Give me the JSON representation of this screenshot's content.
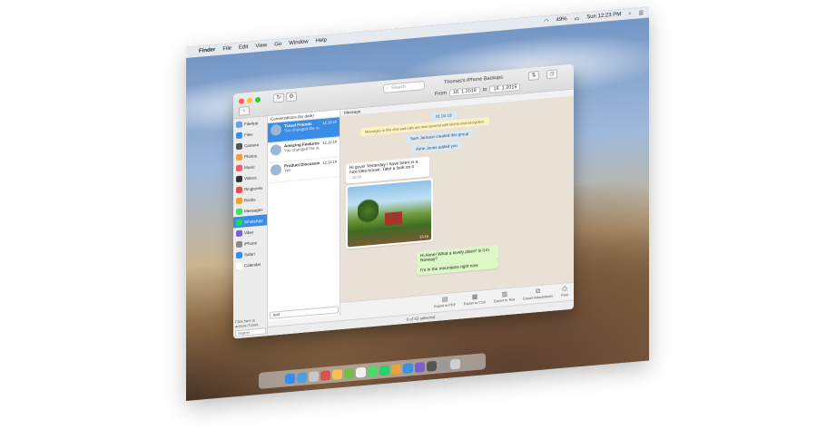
{
  "menubar": {
    "app": "Finder",
    "items": [
      "File",
      "Edit",
      "View",
      "Go",
      "Window",
      "Help"
    ],
    "battery": "49%",
    "clock": "Sun 12:23 PM"
  },
  "toolbar_top": {
    "search_placeholder": "Search",
    "backup_label": "Thomas's iPhone Backups",
    "from_label": "From",
    "from_date": "18. 1.2018",
    "to_label": "to",
    "to_date": "18. 1.2019"
  },
  "sidebar": {
    "items": [
      {
        "label": "FileApp",
        "icon": "fileapp-icon",
        "color": "#6f9fd8"
      },
      {
        "label": "Files",
        "icon": "files-icon",
        "color": "#3d8fe0"
      },
      {
        "label": "Camera",
        "icon": "camera-icon",
        "color": "#555555"
      },
      {
        "label": "Photos",
        "icon": "photos-icon",
        "color": "#e8a33a"
      },
      {
        "label": "Music",
        "icon": "music-icon",
        "color": "#f05a78"
      },
      {
        "label": "Videos",
        "icon": "videos-icon",
        "color": "#333333"
      },
      {
        "label": "Ringtones",
        "icon": "ringtones-icon",
        "color": "#e05050"
      },
      {
        "label": "Books",
        "icon": "books-icon",
        "color": "#f0a030"
      },
      {
        "label": "Messages",
        "icon": "messages-icon",
        "color": "#4cd964"
      },
      {
        "label": "WhatsApp",
        "icon": "whatsapp-icon",
        "color": "#25d366"
      },
      {
        "label": "Viber",
        "icon": "viber-icon",
        "color": "#7a5fd0"
      },
      {
        "label": "iPhone",
        "icon": "iphone-icon",
        "color": "#888888"
      },
      {
        "label": "Safari",
        "icon": "safari-icon",
        "color": "#3a8de6"
      },
      {
        "label": "Calendar",
        "icon": "calendar-icon",
        "color": "#ffffff"
      }
    ],
    "footer": "Click here to access iTunes",
    "search_placeholder": "Search"
  },
  "chatlist": {
    "header": "Conversations (by date)",
    "chats": [
      {
        "name": "Travel Friends",
        "preview": "You changed the subject to \"T...",
        "time": "12.12.18"
      },
      {
        "name": "Amazing Features...",
        "preview": "You changed the subject to \"A...",
        "time": "12.12.18"
      },
      {
        "name": "Product Discussions",
        "preview": "Yes",
        "time": "12.12.18"
      }
    ],
    "search_value": "test"
  },
  "messages": {
    "header": "Message",
    "date_pill": "01.02.19",
    "encryption_note": "Messages to this chat and calls are now secured with end-to-end encryption.",
    "system1": "Sam Jackson created this group",
    "system2": "Aime Jones added you",
    "bubble_in": "Hi guys! Yesterday I have been in a nice lake-house. Take a look on it",
    "bubble_in_time": "12:50",
    "photo_time": "13:15",
    "bubble_out": "Hi Aime! What a lovely place! Is it in Norway?",
    "bubble_out2": "I'm in the mountains right now"
  },
  "bottom_toolbar": {
    "tools": [
      {
        "label": "Export to PDF",
        "icon": "pdf-icon"
      },
      {
        "label": "Export to CSV",
        "icon": "csv-icon"
      },
      {
        "label": "Export to Text",
        "icon": "text-icon"
      },
      {
        "label": "Export Attachments",
        "icon": "attachments-icon"
      },
      {
        "label": "Print",
        "icon": "print-icon"
      }
    ]
  },
  "statusbar": "0 of 53 selected",
  "dock": {
    "colors": [
      "#3a8de6",
      "#4aa0e8",
      "#c7c7c7",
      "#e05050",
      "#f2c14e",
      "#6cc04a",
      "#f0f0f0",
      "#4cd964",
      "#25d366",
      "#e8a33a",
      "#3d8fe0",
      "#7a5fd0",
      "#555555",
      "#9a9a9a",
      "#d0d0d0"
    ]
  }
}
